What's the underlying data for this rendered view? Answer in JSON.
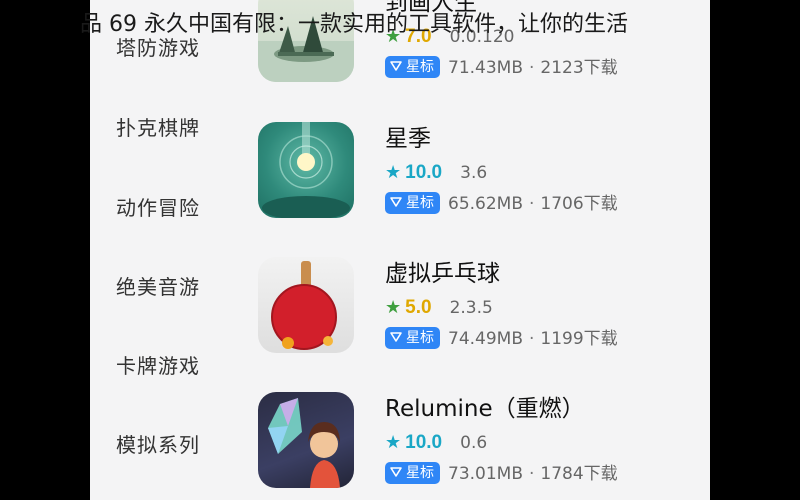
{
  "overlay_title": "品 69 永久中国有限：一款实用的工具软件，让你的生活",
  "sidebar": {
    "items": [
      {
        "label": "塔防游戏"
      },
      {
        "label": "扑克棋牌"
      },
      {
        "label": "动作冒险"
      },
      {
        "label": "绝美音游"
      },
      {
        "label": "卡牌游戏"
      },
      {
        "label": "模拟系列"
      }
    ]
  },
  "colors": {
    "badge": "#2f86f6",
    "green_star": "#3f9f3f",
    "cyan_star": "#1aa7c6",
    "yellow_score": "#e0a800"
  },
  "apps": [
    {
      "name": "到画人生",
      "rating": "7.0",
      "version": "0.0.120",
      "badge": "星标",
      "size": "71.43MB",
      "downloads": "2123下载",
      "star_color": "green",
      "icon": "tree-island-icon"
    },
    {
      "name": "星季",
      "rating": "10.0",
      "version": "3.6",
      "badge": "星标",
      "size": "65.62MB",
      "downloads": "1706下载",
      "star_color": "cyan",
      "icon": "glowing-orb-icon"
    },
    {
      "name": "虚拟乒乓球",
      "rating": "5.0",
      "version": "2.3.5",
      "badge": "星标",
      "size": "74.49MB",
      "downloads": "1199下载",
      "star_color": "green",
      "icon": "ping-pong-paddle-icon"
    },
    {
      "name": "Relumine（重燃）",
      "rating": "10.0",
      "version": "0.6",
      "badge": "星标",
      "size": "73.01MB",
      "downloads": "1784下载",
      "star_color": "cyan",
      "icon": "girl-with-prism-icon"
    }
  ]
}
